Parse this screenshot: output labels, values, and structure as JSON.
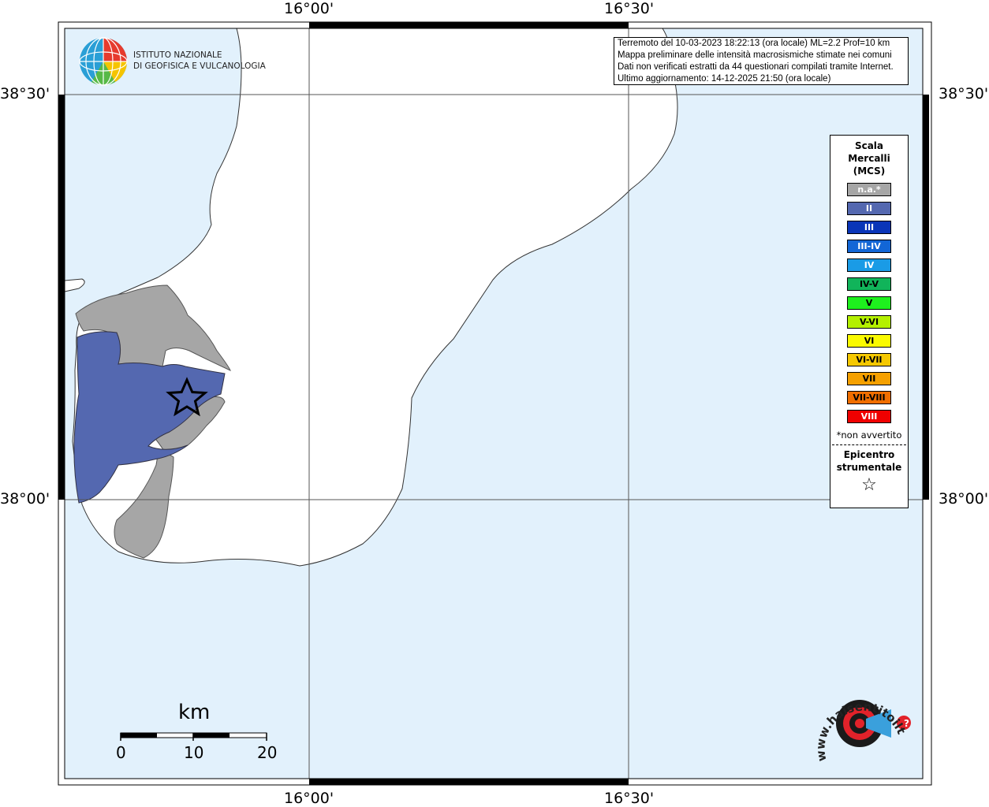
{
  "map": {
    "lon_ticks": [
      "16°00'",
      "16°30'"
    ],
    "lat_ticks": [
      "38°30'",
      "38°00'"
    ],
    "colors": {
      "sea": "#e2f1fc",
      "land": "#ffffff",
      "not_felt": "#a6a6a6",
      "intensity_II": "#5468b0",
      "frame": "#000000"
    }
  },
  "info": {
    "line1": "Terremoto del 10-03-2023 18:22:13 (ora locale) ML=2.2 Prof=10 km",
    "line2": "Mappa preliminare delle intensità macrosismiche stimate nei comuni",
    "line3": "Dati non verificati estratti da 44 questionari compilati tramite Internet.",
    "line4": "Ultimo aggiornamento: 14-12-2025 21:50 (ora locale)"
  },
  "logo": {
    "line1": "ISTITUTO NAZIONALE",
    "line2": "DI GEOFISICA E VULCANOLOGIA",
    "icon": "globe-icon"
  },
  "legend": {
    "title_line1": "Scala",
    "title_line2": "Mercalli",
    "title_line3": "(MCS)",
    "items": [
      {
        "label": "n.a.*",
        "color": "#a6a6a6",
        "text_color": "#ffffff"
      },
      {
        "label": "II",
        "color": "#5468b0",
        "text_color": "#ffffff"
      },
      {
        "label": "III",
        "color": "#0a35b8",
        "text_color": "#ffffff"
      },
      {
        "label": "III-IV",
        "color": "#1266d6",
        "text_color": "#ffffff"
      },
      {
        "label": "IV",
        "color": "#1a9be6",
        "text_color": "#ffffff"
      },
      {
        "label": "IV-V",
        "color": "#11b45a",
        "text_color": "#000000"
      },
      {
        "label": "V",
        "color": "#1ef01e",
        "text_color": "#000000"
      },
      {
        "label": "V-VI",
        "color": "#b4f000",
        "text_color": "#000000"
      },
      {
        "label": "VI",
        "color": "#fafa00",
        "text_color": "#000000"
      },
      {
        "label": "VI-VII",
        "color": "#f5c800",
        "text_color": "#000000"
      },
      {
        "label": "VII",
        "color": "#f5a000",
        "text_color": "#000000"
      },
      {
        "label": "VII-VIII",
        "color": "#f06e00",
        "text_color": "#000000"
      },
      {
        "label": "VIII",
        "color": "#f00000",
        "text_color": "#ffffff"
      }
    ],
    "not_felt_note": "*non avvertito",
    "epicenter_line1": "Epicentro",
    "epicenter_line2": "strumentale",
    "epicenter_symbol": "☆"
  },
  "scale_bar": {
    "unit": "km",
    "labels": [
      "0",
      "10",
      "20"
    ]
  },
  "brand": {
    "text": "www.haisentitoilterremoto.it",
    "question_mark": "?",
    "icon": "target-megaphone-icon"
  }
}
